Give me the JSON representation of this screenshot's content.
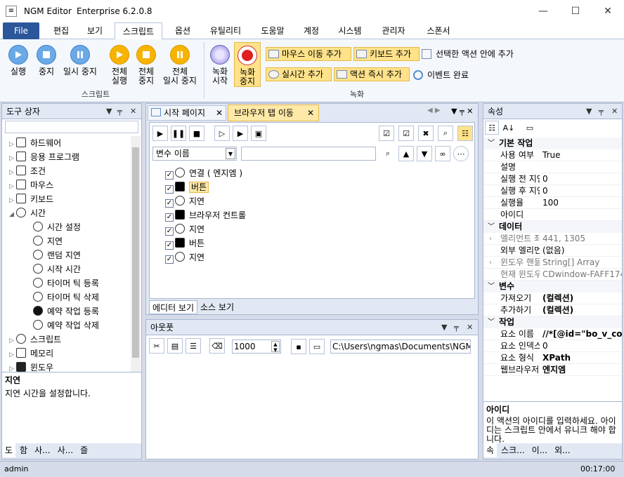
{
  "title": {
    "app": "NGM Editor",
    "edition": "Enterprise 6.2.0.8"
  },
  "menu": [
    "File",
    "편집",
    "보기",
    "스크립트",
    "옵션",
    "유틸리티",
    "도움말",
    "계정",
    "시스템",
    "관리자",
    "스폰서"
  ],
  "ribbon": {
    "run": "실행",
    "stop": "중지",
    "pause": "일시 중지",
    "all_run_1": "전체",
    "all_run_2": "실행",
    "all_stop_1": "전체",
    "all_stop_2": "중지",
    "all_pause_1": "전체",
    "all_pause_2": "일시 중지",
    "script_group": "스크립트",
    "rec_start_1": "녹화",
    "rec_start_2": "시작",
    "rec_stop_1": "녹화",
    "rec_stop_2": "중지",
    "mouse_move": "마우스 이동 추가",
    "keyboard": "키보드 추가",
    "add_inside": "선택한 액션 안에 추가",
    "real_time": "실시간 추가",
    "action_now": "액션 즉시 추가",
    "event_done": "이벤트 완료",
    "rec_group": "녹화"
  },
  "toolbox": {
    "title": "도구 상자",
    "items": [
      {
        "label": "하드웨어",
        "arrow": "▷"
      },
      {
        "label": "응용 프로그램",
        "arrow": "▷"
      },
      {
        "label": "조건",
        "arrow": "▷"
      },
      {
        "label": "마우스",
        "arrow": "▷"
      },
      {
        "label": "키보드",
        "arrow": "▷"
      },
      {
        "label": "시간",
        "arrow": "◢"
      },
      {
        "label": "시간 설정",
        "arrow": ""
      },
      {
        "label": "지연",
        "arrow": ""
      },
      {
        "label": "랜덤 지연",
        "arrow": ""
      },
      {
        "label": "시작 시간",
        "arrow": ""
      },
      {
        "label": "타이머 틱 등록",
        "arrow": ""
      },
      {
        "label": "타이머 틱 삭제",
        "arrow": ""
      },
      {
        "label": "예약 작업 등록",
        "arrow": ""
      },
      {
        "label": "예약 작업 삭제",
        "arrow": ""
      },
      {
        "label": "스크립트",
        "arrow": "▷"
      },
      {
        "label": "메모리",
        "arrow": "▷"
      },
      {
        "label": "윈도우",
        "arrow": "▷"
      }
    ],
    "desc_title": "지연",
    "desc_text": "지연 시간을 설정합니다.",
    "tabs": [
      "도",
      "함",
      "사...",
      "사...",
      "즐"
    ]
  },
  "editor": {
    "tab_start": "시작 페이지",
    "tab_browser": "브라우저 탭 이동",
    "var_combo": "변수 이름",
    "actions": [
      {
        "label": "연결 ( 엔지엠 )"
      },
      {
        "label": "버튼"
      },
      {
        "label": "지연"
      },
      {
        "label": "브라우저 컨트롤"
      },
      {
        "label": "지연"
      },
      {
        "label": "버튼"
      },
      {
        "label": "지연"
      }
    ],
    "bottom_tabs": [
      "에디터 보기",
      "소스 보기"
    ]
  },
  "output": {
    "title": "아웃풋",
    "count": "1000",
    "path": "C:\\Users\\ngmas\\Documents\\NGM6\\"
  },
  "props": {
    "title": "속성",
    "rows": [
      {
        "cat": "기본 작업"
      },
      {
        "k": "사용 여부",
        "v": "True"
      },
      {
        "k": "설명",
        "v": ""
      },
      {
        "k": "실행 전 지연",
        "v": "0"
      },
      {
        "k": "실행 후 지연",
        "v": "0"
      },
      {
        "k": "실행율",
        "v": "100"
      },
      {
        "k": "아이디",
        "v": ""
      },
      {
        "cat": "데이터"
      },
      {
        "k": "엘리먼트 좌표",
        "v": "441, 1305",
        "gray": true,
        "arrow": true
      },
      {
        "k": "외부 엘리먼트",
        "v": "(없음)"
      },
      {
        "k": "윈도우 핸들",
        "v": "String[] Array",
        "gray": true,
        "arrow": true
      },
      {
        "k": "현재 윈도우",
        "v": "CDwindow-FAFF174",
        "gray": true
      },
      {
        "cat": "변수"
      },
      {
        "k": "가져오기",
        "v": "(컬렉션)",
        "bold": true
      },
      {
        "k": "추가하기",
        "v": "(컬렉션)",
        "bold": true
      },
      {
        "cat": "작업"
      },
      {
        "k": "요소 이름",
        "v": "//*[@id=\"bo_v_co",
        "bold": true
      },
      {
        "k": "요소 인덱스",
        "v": "0"
      },
      {
        "k": "요소 형식",
        "v": "XPath",
        "bold": true
      },
      {
        "k": "웹브라우저",
        "v": "엔지엠",
        "bold": true
      }
    ],
    "desc_title": "아이디",
    "desc_text": "이 액션의 아이디를 입력하세요. 아이디는 스크립트 안에서 유니크 해야 합니다.",
    "tabs": [
      "속",
      "스크...",
      "이...",
      "외..."
    ]
  },
  "status": {
    "user": "admin",
    "time": "00:17:00"
  }
}
